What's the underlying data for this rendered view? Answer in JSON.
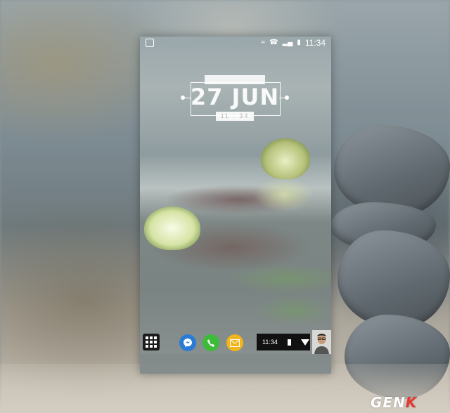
{
  "status_bar": {
    "time": "11:34",
    "icons": [
      "image-notification-icon",
      "wifi-icon",
      "phone-icon",
      "signal-icon",
      "battery-icon"
    ]
  },
  "clock_widget": {
    "date": "27 JUN",
    "time": "11 : 34"
  },
  "dock": {
    "apps": [
      "app-drawer-icon",
      "messenger-icon",
      "phone-call-icon",
      "email-icon"
    ],
    "panel_time": "11:34",
    "panel_icons": [
      "battery-icon",
      "wifi-icon"
    ]
  },
  "watermark": {
    "text_main": "GEN",
    "text_accent": "K"
  },
  "colors": {
    "messenger": "#2a7bd6",
    "phone": "#3dbb3a",
    "email": "#f2b51e",
    "logo_accent": "#e53935"
  }
}
